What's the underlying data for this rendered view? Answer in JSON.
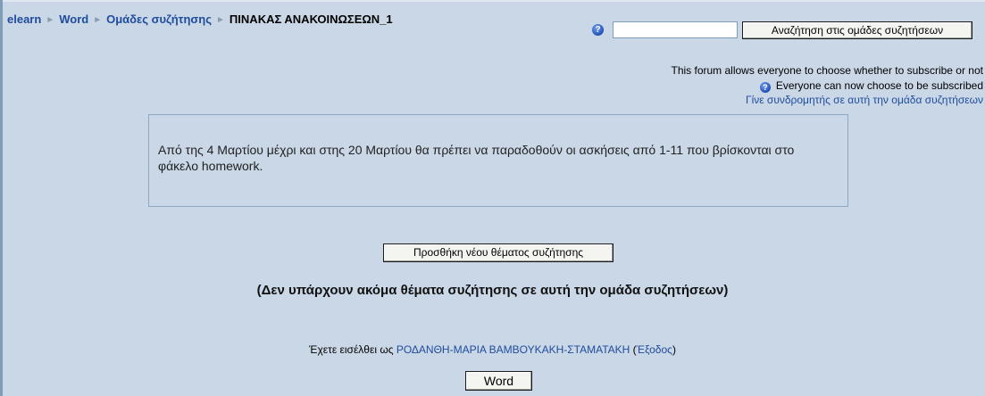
{
  "breadcrumb": {
    "items": [
      "elearn",
      "Word",
      "Ομάδες συζήτησης"
    ],
    "current": "ΠΙΝΑΚΑΣ ΑΝΑΚΟΙΝΩΣΕΩΝ_1",
    "separator": "►"
  },
  "search": {
    "help_icon": "help-icon",
    "value": "",
    "button_label": "Αναζήτηση στις ομάδες συζητήσεων"
  },
  "subscription": {
    "line1": "This forum allows everyone to choose whether to subscribe or not",
    "line2": "Everyone can now choose to be subscribed",
    "link": "Γίνε συνδρομητής σε αυτή την ομάδα συζητήσεων"
  },
  "intro": {
    "text": "Από της 4 Μαρτίου μέχρι και στης 20 Μαρτίου θα πρέπει να παραδοθούν οι ασκήσεις από 1-11 που βρίσκονται στο φάκελο homework."
  },
  "actions": {
    "add_topic_label": "Προσθήκη νέου θέματος συζήτησης",
    "no_topics_text": "(Δεν υπάρχουν ακόμα θέματα συζήτησης σε αυτή την ομάδα συζητήσεων)"
  },
  "footer": {
    "logged_in_prefix": "Έχετε εισέλθει ως",
    "user_name": "ΡΟΔΑΝΘΗ-ΜΑΡΙΑ ΒΑΜΒΟΥΚΑΚΗ-ΣΤΑΜΑΤΑΚΗ",
    "logout_open": "(",
    "logout_label": "Έξοδος",
    "logout_close": ")",
    "course_button": "Word"
  },
  "colors": {
    "background": "#c9d7e6",
    "link": "#1f4c9c",
    "box_border": "#8fa7c3"
  }
}
